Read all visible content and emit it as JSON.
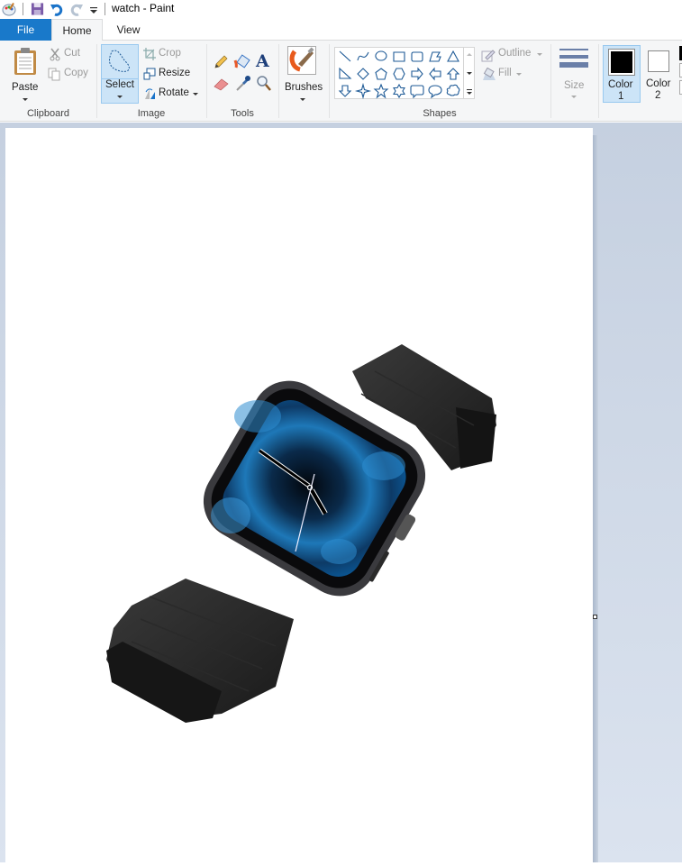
{
  "titlebar": {
    "title": "watch - Paint",
    "quick_access": [
      "paint-app-icon",
      "save-icon",
      "undo-icon",
      "redo-icon",
      "customize-quick-access-icon"
    ]
  },
  "tabs": [
    {
      "label": "File",
      "active": false
    },
    {
      "label": "Home",
      "active": true
    },
    {
      "label": "View",
      "active": false
    }
  ],
  "ribbon": {
    "clipboard": {
      "group_label": "Clipboard",
      "paste": "Paste",
      "cut": "Cut",
      "copy": "Copy"
    },
    "image": {
      "group_label": "Image",
      "select": "Select",
      "crop": "Crop",
      "resize": "Resize",
      "rotate": "Rotate"
    },
    "tools": {
      "group_label": "Tools",
      "items": [
        "pencil",
        "fill-with-color",
        "text",
        "eraser",
        "color-picker",
        "magnifier"
      ]
    },
    "brushes": {
      "label": "Brushes"
    },
    "shapes": {
      "group_label": "Shapes",
      "items": [
        "line",
        "curve",
        "oval",
        "rectangle",
        "rounded-rectangle",
        "polygon",
        "triangle",
        "right-triangle",
        "diamond",
        "pentagon",
        "hexagon",
        "right-arrow",
        "left-arrow",
        "up-arrow",
        "down-arrow",
        "four-point-star",
        "five-point-star",
        "six-point-star",
        "rounded-callout",
        "oval-callout",
        "cloud-callout"
      ],
      "outline": "Outline",
      "fill": "Fill"
    },
    "size": {
      "label": "Size"
    },
    "color1": {
      "label_line1": "Color",
      "label_line2": "1",
      "value": "#000000"
    },
    "color2": {
      "label_line1": "Color",
      "label_line2": "2",
      "value": "#ffffff"
    }
  },
  "canvas": {
    "image_description": "Apple Watch with black leather loop band and blue cloud watch face"
  },
  "colors": {
    "accent": "#1979ca",
    "ribbon_bg": "#f5f6f7",
    "selected_bg": "#cce4f7",
    "selected_border": "#99c9ef",
    "workspace_bg": "#c5d0e0"
  }
}
